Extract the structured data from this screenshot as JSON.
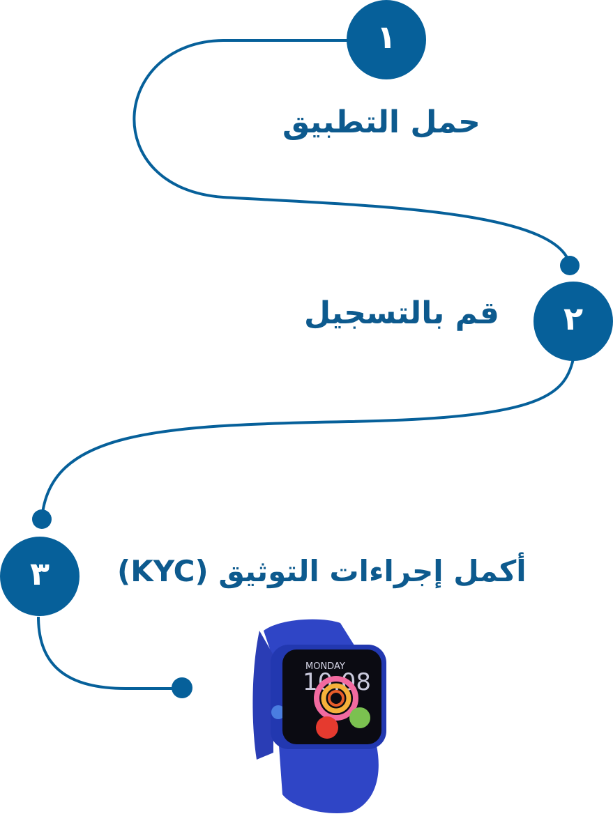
{
  "colors": {
    "primary": "#06609a",
    "text": "#0d5a8e",
    "watch_band": "#2f45c6",
    "watch_screen": "#0b0b12"
  },
  "steps": [
    {
      "number": "١",
      "title": "حمل التطبيق"
    },
    {
      "number": "٢",
      "title": "قم بالتسجيل"
    },
    {
      "number": "٣",
      "title": "أكمل إجراءات التوثيق (KYC)"
    }
  ],
  "watch": {
    "day": "MONDAY",
    "time": "10:08"
  }
}
